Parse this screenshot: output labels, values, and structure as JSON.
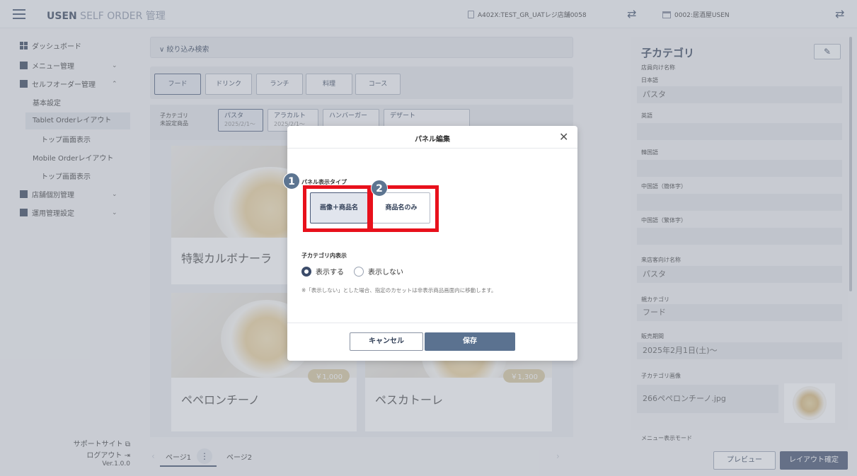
{
  "header": {
    "brand": "USEN",
    "title_light": " SELF ORDER",
    "title_suffix": " 管理",
    "store": "A402X:TEST_GR_UATレジ店舗0058",
    "seat": "0002:居酒屋USEN"
  },
  "sidebar": {
    "dashboard": "ダッシュボード",
    "menu_mgmt": "メニュー管理",
    "selforder_mgmt": "セルフオーダー管理",
    "basic": "基本設定",
    "tablet_layout": "Tablet Orderレイアウト",
    "top_display_1": "トップ画面表示",
    "mobile_layout": "Mobile Orderレイアウト",
    "top_display_2": "トップ画面表示",
    "store_mgmt": "店舗個別管理",
    "ops_mgmt": "運用管理設定",
    "support": "サポートサイト",
    "logout": "ログアウト",
    "version": "Ver.1.0.0"
  },
  "main": {
    "filter_label": "絞り込み検索",
    "categories": [
      "フード",
      "ドリンク",
      "ランチ",
      "料理",
      "コース"
    ],
    "subcat_unset": "子カテゴリ\n未設定商品",
    "subcats": [
      {
        "name": "パスタ",
        "date": "2025/2/1～"
      },
      {
        "name": "アラカルト",
        "date": "2025/2/1～"
      },
      {
        "name": "ハンバーガー",
        "date": ""
      },
      {
        "name": "デザート",
        "date": ""
      }
    ],
    "cards": [
      {
        "name": "特製カルボナーラ",
        "price": ""
      },
      {
        "name": "ペペロンチーノ",
        "price": "￥1,000"
      },
      {
        "name": "ペスカトーレ",
        "price": "￥1,300"
      }
    ],
    "pages": [
      "ページ1",
      "ページ2"
    ]
  },
  "modal": {
    "title": "パネル編集",
    "display_type_label": "パネル表示タイプ",
    "type_image_name": "画像＋商品名",
    "type_name_only": "商品名のみ",
    "subcat_display_label": "子カテゴリ内表示",
    "radio_show": "表示する",
    "radio_hide": "表示しない",
    "note": "※「表示しない」とした場合、指定のカセットは非表示商品画面内に移動します。",
    "cancel": "キャンセル",
    "save": "保存",
    "badge_1": "1",
    "badge_2": "2"
  },
  "right_panel": {
    "title": "子カテゴリ",
    "staff_name_label": "店員向け名称",
    "ja_label": "日本語",
    "ja_value": "パスタ",
    "en_label": "英語",
    "ko_label": "韓国語",
    "zh_s_label": "中国語（簡体字）",
    "zh_t_label": "中国語（繁体字）",
    "customer_name_label": "来店客向け名称",
    "customer_name_value": "パスタ",
    "parent_label": "親カテゴリ",
    "parent_value": "フード",
    "period_label": "販売期間",
    "period_value": "2025年2月1日(土)～",
    "image_label": "子カテゴリ画像",
    "image_value": "266ペペロンチーノ.jpg",
    "mode_label": "メニュー表示モード",
    "preview": "プレビュー",
    "confirm": "レイアウト確定"
  },
  "colors": {
    "accent": "#3c4c6a",
    "highlight": "#e8101b",
    "badge": "#5d7591"
  }
}
